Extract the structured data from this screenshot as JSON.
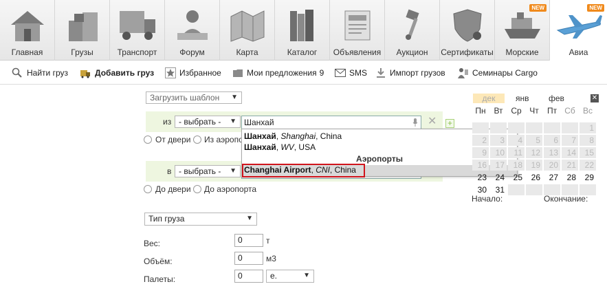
{
  "nav": {
    "tabs": [
      {
        "label": "Главная",
        "icon": "house-icon"
      },
      {
        "label": "Грузы",
        "icon": "cargo-boxes-icon"
      },
      {
        "label": "Транспорт",
        "icon": "truck-icon"
      },
      {
        "label": "Форум",
        "icon": "forum-person-icon"
      },
      {
        "label": "Карта",
        "icon": "map-icon"
      },
      {
        "label": "Каталог",
        "icon": "catalog-books-icon"
      },
      {
        "label": "Объявления",
        "icon": "newspaper-icon"
      },
      {
        "label": "Аукцион",
        "icon": "auction-hammer-icon"
      },
      {
        "label": "Сертификаты",
        "icon": "certificate-shield-icon"
      },
      {
        "label": "Морские",
        "icon": "ship-icon",
        "badge": "NEW"
      },
      {
        "label": "Авиа",
        "icon": "airplane-icon",
        "badge": "NEW",
        "active": true
      }
    ]
  },
  "toolbar": {
    "find_cargo": "Найти груз",
    "add_cargo": "Добавить груз",
    "favorites": "Избранное",
    "my_offers": "Мои предложения",
    "my_offers_count": "9",
    "sms": "SMS",
    "import": "Импорт грузов",
    "seminars": "Семинары Cargo"
  },
  "form": {
    "template_select": "Загрузить шаблон",
    "from_label": "из",
    "from_select": "- выбрать -",
    "from_input": "Шанхай",
    "from_door": "От двери",
    "from_airport": "Из аэропо",
    "to_label": "в",
    "to_select": "- выбрать -",
    "to_door": "До двери",
    "to_airport": "До аэропорта",
    "cargo_type": "Тип груза",
    "weight_label": "Вес:",
    "weight_value": "0",
    "weight_unit": "т",
    "volume_label": "Объём:",
    "volume_value": "0",
    "volume_unit": "м3",
    "pallets_label": "Палеты:",
    "pallets_value": "0",
    "pallets_unit": "е."
  },
  "suggest": {
    "row1_bold": "Шанхай",
    "row1_italic": "Shanghai",
    "row1_rest": "China",
    "row2_bold": "Шанхай",
    "row2_italic": "WV",
    "row2_rest": "USA",
    "section": "Аэропорты",
    "row3_bold": "Changhai Airport",
    "row3_italic": "CNI",
    "row3_rest": "China"
  },
  "calendar": {
    "months": [
      "дек",
      "янв",
      "фев"
    ],
    "weekdays": [
      "Пн",
      "Вт",
      "Ср",
      "Чт",
      "Пт",
      "Сб",
      "Вс"
    ],
    "grid_rows": [
      [
        "",
        "",
        "",
        "",
        "",
        "",
        "1"
      ],
      [
        "2",
        "3",
        "4",
        "5",
        "6",
        "7",
        "8"
      ],
      [
        "9",
        "10",
        "11",
        "12",
        "13",
        "14",
        "15"
      ],
      [
        "16",
        "17",
        "18",
        "19",
        "20",
        "21",
        "22"
      ],
      [
        "23",
        "24",
        "25",
        "26",
        "27",
        "28",
        "29"
      ],
      [
        "30",
        "31",
        "",
        "",
        "",
        "",
        ""
      ]
    ],
    "start_label": "Начало:",
    "end_label": "Окончание:"
  },
  "colors": {
    "accent_orange": "#f08a1c",
    "highlight_red": "#d0141c",
    "green_row": "#eef6e0"
  }
}
